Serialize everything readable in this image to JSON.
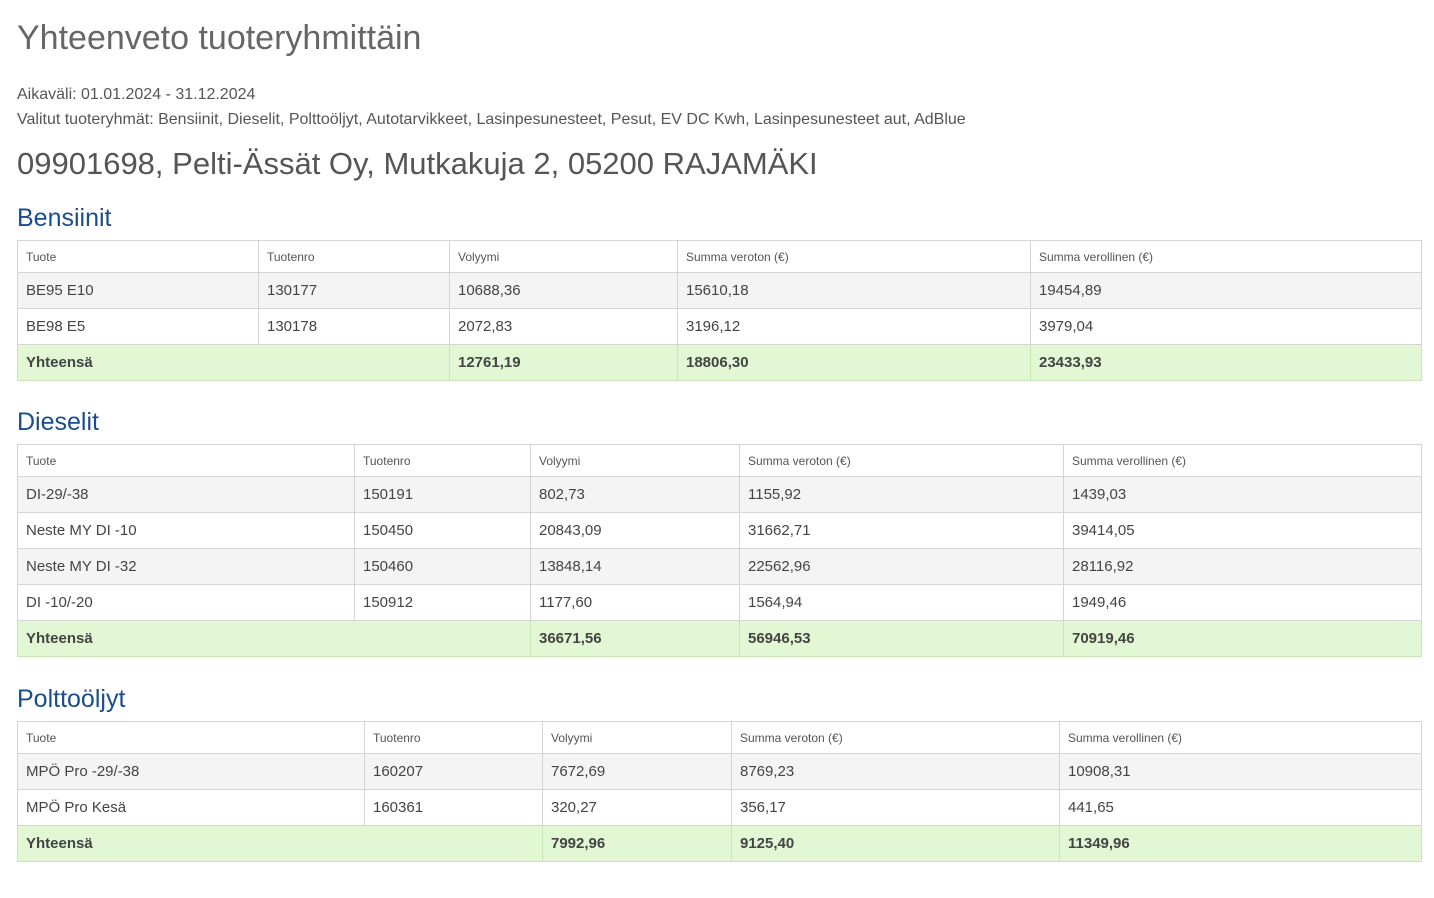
{
  "page": {
    "title": "Yhteenveto tuoteryhmittäin",
    "period": "Aikaväli: 01.01.2024 - 31.12.2024",
    "selected_groups": "Valitut tuoteryhmät: Bensiinit, Dieselit, Polttoöljyt, Autotarvikkeet, Lasinpesunesteet, Pesut, EV DC Kwh, Lasinpesunesteet aut, AdBlue",
    "customer": "09901698, Pelti-Ässät Oy, Mutkakuja 2, 05200 RAJAMÄKI"
  },
  "columns": {
    "product": "Tuote",
    "product_no": "Tuotenro",
    "volume": "Volyymi",
    "sum_net": "Summa veroton (€)",
    "sum_gross": "Summa verollinen (€)"
  },
  "groups": [
    {
      "name": "Bensiinit",
      "rows": [
        {
          "product": "BE95 E10",
          "product_no": "130177",
          "volume": "10688,36",
          "sum_net": "15610,18",
          "sum_gross": "19454,89"
        },
        {
          "product": "BE98 E5",
          "product_no": "130178",
          "volume": "2072,83",
          "sum_net": "3196,12",
          "sum_gross": "3979,04"
        }
      ],
      "total": {
        "label": "Yhteensä",
        "volume": "12761,19",
        "sum_net": "18806,30",
        "sum_gross": "23433,93"
      }
    },
    {
      "name": "Dieselit",
      "rows": [
        {
          "product": "DI-29/-38",
          "product_no": "150191",
          "volume": "802,73",
          "sum_net": "1155,92",
          "sum_gross": "1439,03"
        },
        {
          "product": "Neste MY DI -10",
          "product_no": "150450",
          "volume": "20843,09",
          "sum_net": "31662,71",
          "sum_gross": "39414,05"
        },
        {
          "product": "Neste MY DI -32",
          "product_no": "150460",
          "volume": "13848,14",
          "sum_net": "22562,96",
          "sum_gross": "28116,92"
        },
        {
          "product": "DI -10/-20",
          "product_no": "150912",
          "volume": "1177,60",
          "sum_net": "1564,94",
          "sum_gross": "1949,46"
        }
      ],
      "total": {
        "label": "Yhteensä",
        "volume": "36671,56",
        "sum_net": "56946,53",
        "sum_gross": "70919,46"
      }
    },
    {
      "name": "Polttoöljyt",
      "rows": [
        {
          "product": "MPÖ Pro -29/-38",
          "product_no": "160207",
          "volume": "7672,69",
          "sum_net": "8769,23",
          "sum_gross": "10908,31"
        },
        {
          "product": "MPÖ Pro Kesä",
          "product_no": "160361",
          "volume": "320,27",
          "sum_net": "356,17",
          "sum_gross": "441,65"
        }
      ],
      "total": {
        "label": "Yhteensä",
        "volume": "7992,96",
        "sum_net": "9125,40",
        "sum_gross": "11349,96"
      }
    }
  ]
}
